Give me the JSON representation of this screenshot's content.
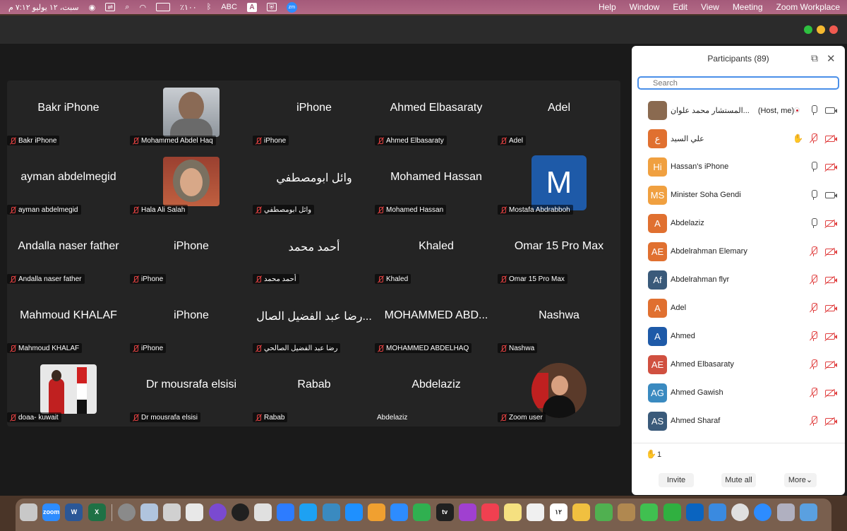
{
  "menubar": {
    "app_items": [
      "Help",
      "Window",
      "Edit",
      "View",
      "Meeting",
      "Zoom Workplace"
    ],
    "clock": "سبت، ١٢ يوليو ٧:١٢ م",
    "battery": "٪١٠٠",
    "input_source": "ABC",
    "input_badge": "A",
    "zoom_badge": "zm"
  },
  "gallery": {
    "tiles": [
      {
        "big": "Bakr iPhone",
        "label": "Bakr iPhone",
        "muted": true
      },
      {
        "big": "",
        "label": "Mohammed Abdel Haq",
        "muted": true,
        "photo": "man-photo"
      },
      {
        "big": "iPhone",
        "label": "iPhone",
        "muted": true
      },
      {
        "big": "Ahmed Elbasaraty",
        "label": "Ahmed Elbasaraty",
        "muted": true
      },
      {
        "big": "Adel",
        "label": "Adel",
        "muted": true
      },
      {
        "big": "ayman abdelmegid",
        "label": "ayman abdelmegid",
        "muted": true
      },
      {
        "big": "",
        "label": "Hala Ali Salah",
        "muted": true,
        "photo": "woman-photo"
      },
      {
        "big": "وائل ابومصطفي",
        "label": "وائل ابومصطفي",
        "muted": true
      },
      {
        "big": "Mohamed Hassan",
        "label": "Mohamed Hassan",
        "muted": true
      },
      {
        "big": "M",
        "label": "Mostafa Abdrabboh",
        "muted": true,
        "avatar": true
      },
      {
        "big": "Andalla naser father",
        "label": "Andalla naser father",
        "muted": true
      },
      {
        "big": "iPhone",
        "label": "iPhone",
        "muted": true
      },
      {
        "big": "أحمد محمد",
        "label": "أحمد محمد",
        "muted": true
      },
      {
        "big": "Khaled",
        "label": "Khaled",
        "muted": true
      },
      {
        "big": "Omar 15 Pro Max",
        "label": "Omar 15 Pro Max",
        "muted": true
      },
      {
        "big": "Mahmoud KHALAF",
        "label": "Mahmoud KHALAF",
        "muted": true
      },
      {
        "big": "iPhone",
        "label": "iPhone",
        "muted": true
      },
      {
        "big": "رضا عبد الفضيل الصال...",
        "label": "رضا عبد الفضيل الصالحي",
        "muted": true
      },
      {
        "big": "MOHAMMED ABD...",
        "label": "MOHAMMED ABDELHAQ",
        "muted": true
      },
      {
        "big": "Nashwa",
        "label": "Nashwa",
        "muted": true
      },
      {
        "big": "",
        "label": "doaa- kuwait",
        "muted": true,
        "photo": "flag-photo"
      },
      {
        "big": "Dr mousrafa elsisi",
        "label": "Dr mousrafa elsisi",
        "muted": true
      },
      {
        "big": "Rabab",
        "label": "Rabab",
        "muted": true
      },
      {
        "big": "Abdelaziz",
        "label": "Abdelaziz",
        "muted": false
      },
      {
        "big": "",
        "label": "Zoom user",
        "muted": true,
        "photo": "round-photo"
      }
    ]
  },
  "participants": {
    "title": "Participants (89)",
    "search_placeholder": "Search",
    "rows": [
      {
        "initials": "",
        "name": "المستشار محمد علوان...",
        "tag": "(Host, me)",
        "color": "#8a6a50",
        "mic": "on",
        "cam": "on",
        "flag": true
      },
      {
        "initials": "ع",
        "name": "علي السيد",
        "color": "#e07030",
        "mic": "off",
        "cam": "off",
        "hand": true
      },
      {
        "initials": "Hi",
        "name": "Hassan's iPhone",
        "color": "#f0a040",
        "mic": "on",
        "cam": "off"
      },
      {
        "initials": "MS",
        "name": "Minister Soha Gendi",
        "color": "#f0a040",
        "mic": "on",
        "cam": "on"
      },
      {
        "initials": "A",
        "name": "Abdelaziz",
        "color": "#e07030",
        "mic": "on",
        "cam": "off"
      },
      {
        "initials": "AE",
        "name": "Abdelrahman Elemary",
        "color": "#e07030",
        "mic": "off",
        "cam": "off"
      },
      {
        "initials": "Af",
        "name": "Abdelrahman flyr",
        "color": "#3a5a7a",
        "mic": "off",
        "cam": "off"
      },
      {
        "initials": "A",
        "name": "Adel",
        "color": "#e07030",
        "mic": "off",
        "cam": "off"
      },
      {
        "initials": "A",
        "name": "Ahmed",
        "color": "#1e5aa8",
        "mic": "off",
        "cam": "off"
      },
      {
        "initials": "AE",
        "name": "Ahmed Elbasaraty",
        "color": "#d05040",
        "mic": "off",
        "cam": "off"
      },
      {
        "initials": "AG",
        "name": "Ahmed Gawish",
        "color": "#3a8ac0",
        "mic": "off",
        "cam": "off"
      },
      {
        "initials": "AS",
        "name": "Ahmed Sharaf",
        "color": "#3a5a7a",
        "mic": "off",
        "cam": "off"
      }
    ],
    "raised_hands": "1",
    "invite_label": "Invite",
    "mute_all_label": "Mute all",
    "more_label": "More"
  },
  "dock": {
    "items": [
      {
        "name": "trash-icon",
        "color": "#c8c8c8"
      },
      {
        "name": "zoom-icon",
        "color": "#2d8cff",
        "text": "zoom"
      },
      {
        "name": "word-icon",
        "color": "#2b5797",
        "text": "W"
      },
      {
        "name": "excel-icon",
        "color": "#1e7145",
        "text": "X"
      },
      {
        "name": "system-preferences-icon",
        "color": "#8a8a8a"
      },
      {
        "name": "preview-icon",
        "color": "#b0c4de"
      },
      {
        "name": "printer-icon",
        "color": "#d0d0d0"
      },
      {
        "name": "scanner-icon",
        "color": "#e8e8e8"
      },
      {
        "name": "siri-icon",
        "color": "#7a4ad0"
      },
      {
        "name": "activity-icon",
        "color": "#202020"
      },
      {
        "name": "whatsapp-icon",
        "color": "#e0e0e0"
      },
      {
        "name": "messenger-icon",
        "color": "#2d7cff"
      },
      {
        "name": "twitter-icon",
        "color": "#1da1f2"
      },
      {
        "name": "shield-icon",
        "color": "#3a8ac0"
      },
      {
        "name": "app-store-icon",
        "color": "#1e90ff"
      },
      {
        "name": "pages-icon",
        "color": "#f0a030"
      },
      {
        "name": "keynote-icon",
        "color": "#2d8cff"
      },
      {
        "name": "numbers-icon",
        "color": "#30b050"
      },
      {
        "name": "tv-icon",
        "color": "#202020",
        "text": "tv"
      },
      {
        "name": "podcasts-icon",
        "color": "#a040d0"
      },
      {
        "name": "music-icon",
        "color": "#f04050"
      },
      {
        "name": "notes-icon",
        "color": "#f5e080"
      },
      {
        "name": "reminders-icon",
        "color": "#f0f0f0"
      },
      {
        "name": "calendar-icon",
        "color": "#ffffff",
        "text": "١٢"
      },
      {
        "name": "photos-icon",
        "color": "#f0c040"
      },
      {
        "name": "maps-icon",
        "color": "#50b050"
      },
      {
        "name": "finder-bag-icon",
        "color": "#b08850"
      },
      {
        "name": "messages-icon",
        "color": "#40c050"
      },
      {
        "name": "facetime-icon",
        "color": "#30b040"
      },
      {
        "name": "outlook-icon",
        "color": "#0a64c0"
      },
      {
        "name": "mail-icon",
        "color": "#3a8ae0"
      },
      {
        "name": "chrome-icon",
        "color": "#e0e0e0"
      },
      {
        "name": "safari-icon",
        "color": "#2d8cff"
      },
      {
        "name": "launchpad-icon",
        "color": "#b0b0c0"
      },
      {
        "name": "finder-icon",
        "color": "#5aa0e0"
      }
    ]
  }
}
